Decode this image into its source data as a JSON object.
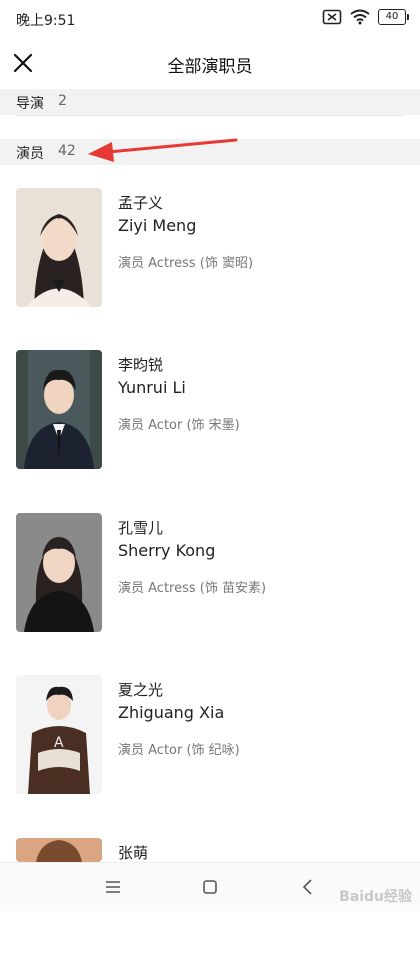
{
  "status_bar": {
    "time": "晚上9:51",
    "battery": "40"
  },
  "header": {
    "title": "全部演职员"
  },
  "sections": [
    {
      "label": "导演",
      "count": "2"
    },
    {
      "label": "演员",
      "count": "42"
    }
  ],
  "cast": [
    {
      "name_cn": "孟子义",
      "name_en": "Ziyi Meng",
      "role": "演员 Actress (饰 窦昭)"
    },
    {
      "name_cn": "李昀锐",
      "name_en": "Yunrui Li",
      "role": "演员 Actor (饰 宋墨)"
    },
    {
      "name_cn": "孔雪儿",
      "name_en": "Sherry Kong",
      "role": "演员 Actress (饰 苗安素)"
    },
    {
      "name_cn": "夏之光",
      "name_en": "Zhiguang Xia",
      "role": "演员 Actor (饰 纪咏)"
    },
    {
      "name_cn": "张萌",
      "name_en": "",
      "role": ""
    }
  ],
  "watermark": "Baidu经验",
  "colors": {
    "arrow": "#e53935",
    "section_bg": "#f2f2f2"
  }
}
